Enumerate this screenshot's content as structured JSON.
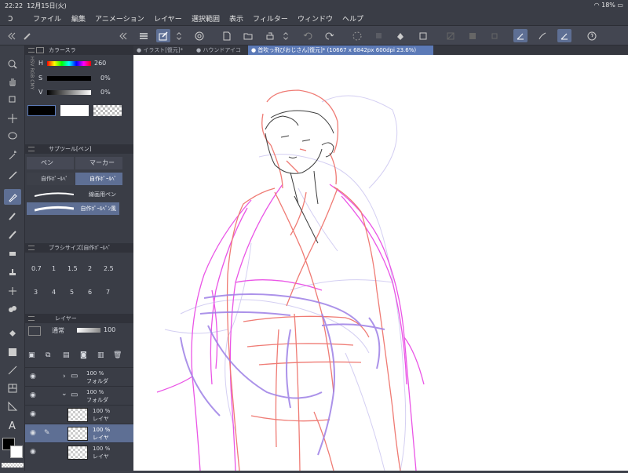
{
  "status": {
    "time": "22:22",
    "date": "12月15日(火)",
    "battery": "18%"
  },
  "menu": [
    "ファイル",
    "編集",
    "アニメーション",
    "レイヤー",
    "選択範囲",
    "表示",
    "フィルター",
    "ウィンドウ",
    "ヘルプ"
  ],
  "tabs": [
    {
      "label": "● イラスト[復元]*",
      "active": false
    },
    {
      "label": "● ハウンドアイコ",
      "active": false
    },
    {
      "label": "● 首吹っ飛びおじさん[復元]* (10667 x 6842px 600dpi 23.6%)",
      "active": true
    }
  ],
  "color_panel": {
    "title": "カラースラ",
    "mode_tabs": [
      "HSV",
      "RGB",
      "CMY"
    ],
    "h_label": "H",
    "h_value": "260",
    "s_label": "S",
    "s_value": "0%",
    "v_label": "V",
    "v_value": "0%"
  },
  "subtool_panel": {
    "title": "サブツール[ペン]",
    "groups": [
      "ペン",
      "マーカー"
    ],
    "sets": [
      "自作ﾎﾟｰﾙﾍﾟ",
      "自作ﾎﾟｰﾙﾍﾟ"
    ],
    "brushes": [
      "線画用ペン",
      "自作ﾎﾟｰﾙﾍﾟﾝ風"
    ]
  },
  "brush_size_panel": {
    "title": "ブラシサイズ[自作ﾎﾟｰﾙﾍﾟ",
    "sizes_row1": [
      "0.7",
      "1",
      "1.5",
      "2",
      "2.5"
    ],
    "sizes_row2": [
      "3",
      "4",
      "5",
      "6",
      "7"
    ]
  },
  "layer_panel": {
    "title": "レイヤー",
    "blend_mode": "通常",
    "opacity": "100",
    "layers": [
      {
        "opacity": "100 %",
        "name": "フォルダ",
        "type": "folder",
        "active": false
      },
      {
        "opacity": "100 %",
        "name": "フォルダ",
        "type": "folder",
        "active": false
      },
      {
        "opacity": "100 %",
        "name": "レイヤ",
        "type": "layer",
        "active": false
      },
      {
        "opacity": "100 %",
        "name": "レイヤ",
        "type": "layer",
        "active": true
      },
      {
        "opacity": "100 %",
        "name": "レイヤ",
        "type": "layer",
        "active": false
      }
    ]
  },
  "colors": {
    "accent": "#5e6f94",
    "tab_active": "#5c7ab7",
    "main_color": "#000000",
    "sub_color": "#ffffff"
  }
}
